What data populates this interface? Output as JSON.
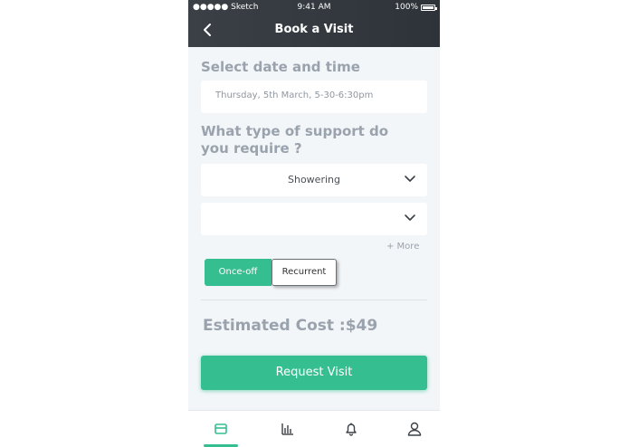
{
  "status_bar": {
    "carrier": "●●●●● Sketch",
    "time": "9:41 AM",
    "battery": "100%"
  },
  "header": {
    "title": "Book a Visit",
    "back_icon": "chevron-left-icon"
  },
  "date_section": {
    "label": "Select date and time",
    "value": "Thursday, 5th March, 5-30-6:30pm"
  },
  "support_section": {
    "label_line1": "What type of support do",
    "label_line2": "you require ?",
    "dropdown1_value": "Showering",
    "dropdown2_value": "",
    "more_link": "+ More"
  },
  "frequency_toggle": {
    "option1": "Once-off",
    "option2": "Recurrent",
    "selected": "Once-off"
  },
  "estimate": {
    "text": "Estimated Cost :$49"
  },
  "actions": {
    "request_label": "Request Visit"
  },
  "tabbar": {
    "items": [
      "card-icon",
      "bar-chart-icon",
      "bell-icon",
      "user-icon"
    ],
    "active_index": 0
  },
  "colors": {
    "accent": "#35bf90",
    "header_bg": "#353b41",
    "muted_text": "#9aa3ad",
    "background": "#f3f6f9"
  }
}
